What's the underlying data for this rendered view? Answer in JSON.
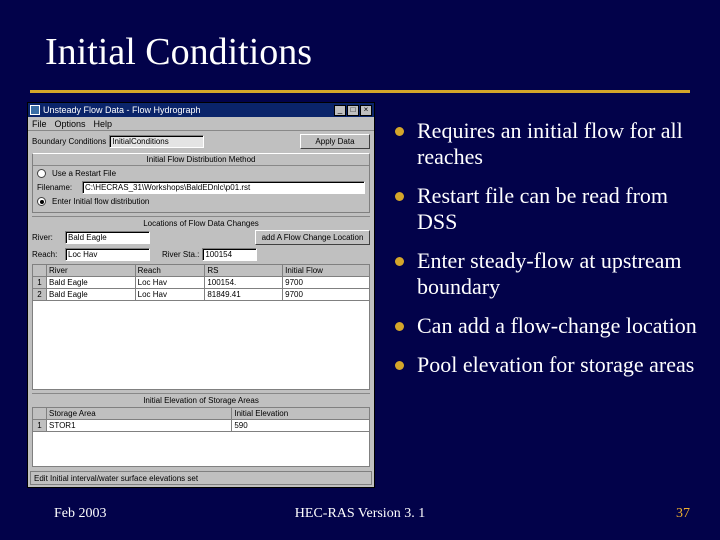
{
  "slide": {
    "title": "Initial Conditions",
    "footer_left": "Feb 2003",
    "footer_center": "HEC-RAS Version 3. 1",
    "footer_page": "37"
  },
  "bullets": [
    "Requires an initial flow for all reaches",
    "Restart file can be read from DSS",
    "Enter steady-flow at upstream boundary",
    "Can add a flow-change location",
    "Pool elevation for storage areas"
  ],
  "win": {
    "title": "Unsteady Flow Data - Flow Hydrograph",
    "sys_min": "_",
    "sys_max": "□",
    "sys_close": "×",
    "menu": {
      "file": "File",
      "options": "Options",
      "help": "Help"
    },
    "bc_label": "Boundary Conditions",
    "bc_value": "InitialConditions",
    "apply_btn": "Apply Data",
    "group_flowdist": "Initial Flow Distribution Method",
    "radio_restart": "Use a Restart File",
    "filename_label": "Filename:",
    "filename_value": "C:\\HECRAS_31\\Workshops\\BaldEDnlc\\p01.rst",
    "radio_enter": "Enter Initial flow distribution",
    "panel1_title": "Locations of Flow Data Changes",
    "river_label": "River:",
    "river_value": "Bald Eagle",
    "addflow_btn": "add A Flow Change Location",
    "reach_label": "Reach:",
    "reach_value": "Loc Hav",
    "rs_label": "River Sta.:",
    "rs_value": "100154",
    "grid1": {
      "headers": [
        "",
        "River",
        "Reach",
        "RS",
        "Initial Flow"
      ],
      "rows": [
        [
          "1",
          "Bald Eagle",
          "Loc Hav",
          "100154.",
          "9700"
        ],
        [
          "2",
          "Bald Eagle",
          "Loc Hav",
          "81849.41",
          "9700"
        ]
      ]
    },
    "panel2_title": "Initial Elevation of Storage Areas",
    "grid2": {
      "headers": [
        "",
        "Storage Area",
        "Initial Elevation"
      ],
      "rows": [
        [
          "1",
          "STOR1",
          "590"
        ]
      ]
    },
    "status": "Edit Initial interval/water surface elevations set"
  }
}
